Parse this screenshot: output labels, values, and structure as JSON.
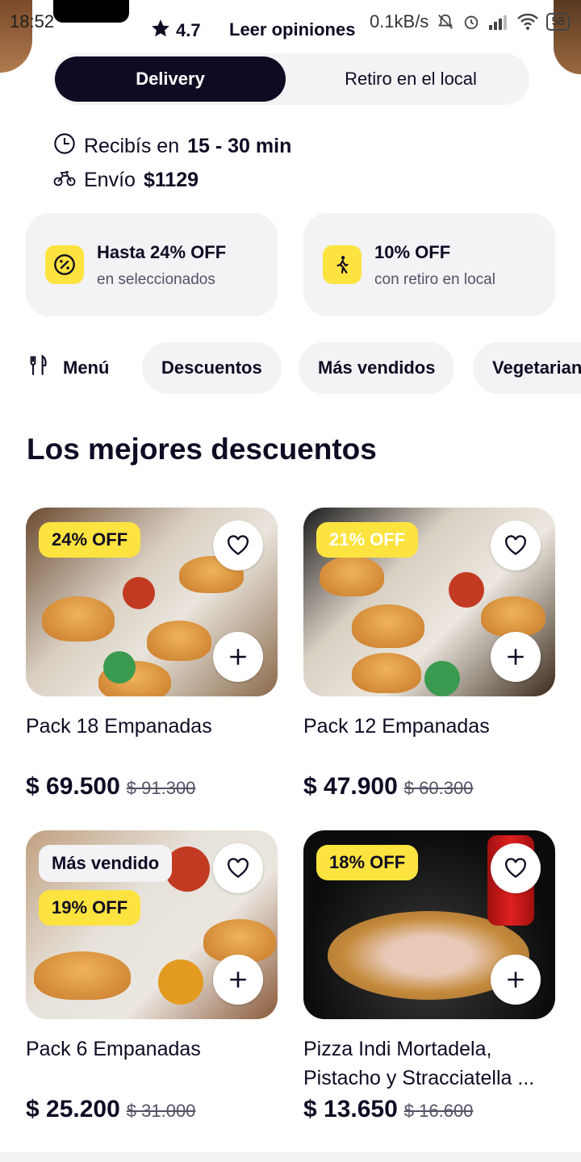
{
  "status_bar": {
    "time": "18:52",
    "net_speed": "0.1kB/s",
    "battery": "58"
  },
  "header": {
    "rating": "4.7",
    "reviews_link": "Leer opiniones"
  },
  "delivery_toggle": {
    "active": "Delivery",
    "inactive": "Retiro en el local"
  },
  "info": {
    "time_prefix": "Recibís en",
    "time_value": "15 - 30 min",
    "shipping_prefix": "Envío",
    "shipping_value": "$1129"
  },
  "promos": [
    {
      "title": "Hasta 24% OFF",
      "subtitle": "en seleccionados",
      "icon": "percent-icon"
    },
    {
      "title": "10% OFF",
      "subtitle": "con retiro en local",
      "icon": "walking-person-icon"
    }
  ],
  "categories": {
    "menu": "Menú",
    "chips": [
      "Descuentos",
      "Más vendidos",
      "Vegetarian"
    ]
  },
  "section_title": "Los mejores descuentos",
  "products": [
    {
      "name": "Pack 18 Empanadas",
      "discount": "24% OFF",
      "price": "$ 69.500",
      "old_price": "$ 91.300"
    },
    {
      "name": "Pack 12 Empanadas",
      "discount": "21% OFF",
      "price": "$ 47.900",
      "old_price": "$ 60.300"
    },
    {
      "name": "Pack 6 Empanadas",
      "tag": "Más vendido",
      "discount": "19% OFF",
      "price": "$ 25.200",
      "old_price": "$ 31.000"
    },
    {
      "name": "Pizza Indi Mortadela, Pistacho y Stracciatella ...",
      "discount": "18% OFF",
      "price": "$ 13.650",
      "old_price": "$ 16.600"
    }
  ],
  "colors": {
    "dark": "#100a23",
    "chip_bg": "#f3f2f5",
    "accent_yellow": "#fde33f"
  }
}
